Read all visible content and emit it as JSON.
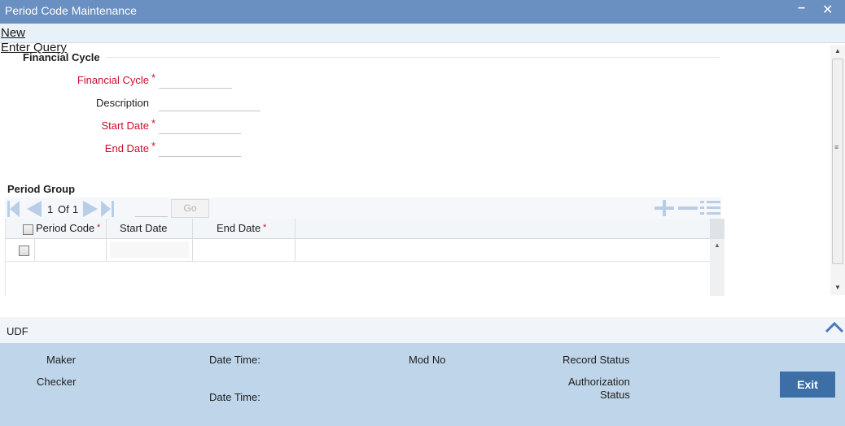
{
  "window": {
    "title": "Period Code Maintenance"
  },
  "toolbar": {
    "new_label": "New",
    "enter_query_label": "Enter Query"
  },
  "financial_cycle": {
    "section_title": "Financial Cycle",
    "fields": {
      "financial_cycle": {
        "label": "Financial Cycle",
        "value": ""
      },
      "description": {
        "label": "Description",
        "value": ""
      },
      "start_date": {
        "label": "Start Date",
        "value": ""
      },
      "end_date": {
        "label": "End Date",
        "value": ""
      }
    },
    "required_marker": "*"
  },
  "period_group": {
    "section_title": "Period Group",
    "pagination": {
      "current": "1",
      "of_label": "Of",
      "total": "1",
      "page_input": "",
      "go_label": "Go"
    },
    "columns": [
      {
        "label": "Period Code",
        "required": true
      },
      {
        "label": "Start Date",
        "required": false
      },
      {
        "label": "End Date",
        "required": true
      }
    ],
    "rows": [
      {
        "period_code": "",
        "start_date": "",
        "end_date": ""
      }
    ]
  },
  "udf": {
    "label": "UDF"
  },
  "footer": {
    "maker_label": "Maker",
    "checker_label": "Checker",
    "date_time_label": "Date Time:",
    "mod_no_label": "Mod No",
    "record_status_label": "Record Status",
    "authorization_status_line1": "Authorization",
    "authorization_status_line2": "Status",
    "exit_label": "Exit"
  },
  "colors": {
    "title_bar": "#6a8fc1",
    "required": "#c8102e",
    "footer": "#bfd6ea",
    "exit_button": "#3d6fa7",
    "nav_icons": "#b8cde6"
  }
}
